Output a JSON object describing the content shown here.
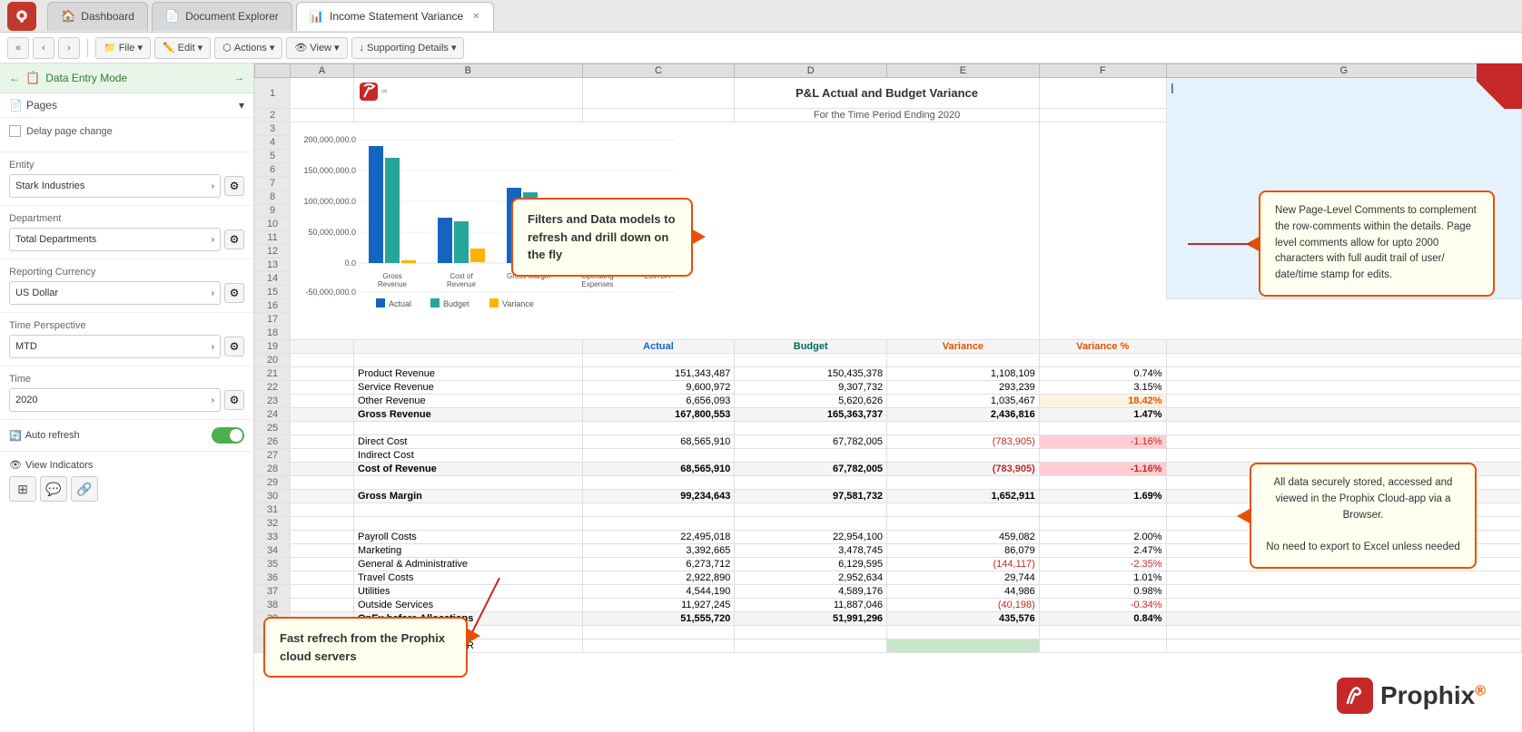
{
  "tabs": [
    {
      "id": "dashboard",
      "label": "Dashboard",
      "icon": "🏠",
      "active": false
    },
    {
      "id": "doc-explorer",
      "label": "Document Explorer",
      "icon": "📄",
      "active": false
    },
    {
      "id": "income-statement",
      "label": "Income Statement Variance",
      "icon": "📊",
      "active": true,
      "closable": true
    }
  ],
  "toolbar": {
    "nav_back_back": "«",
    "nav_back": "‹",
    "nav_forward": "›",
    "file_label": "File",
    "edit_label": "Edit",
    "actions_label": "Actions",
    "view_label": "View",
    "supporting_details_label": "Supporting Details"
  },
  "sidebar": {
    "data_entry_mode": "Data Entry Mode",
    "pages_label": "Pages",
    "delay_page_change": "Delay page change",
    "entity_label": "Entity",
    "entity_value": "Stark Industries",
    "department_label": "Department",
    "department_value": "Total Departments",
    "reporting_currency_label": "Reporting Currency",
    "reporting_currency_value": "US Dollar",
    "time_perspective_label": "Time Perspective",
    "time_perspective_value": "MTD",
    "time_label": "Time",
    "time_value": "2020",
    "auto_refresh_label": "Auto refresh",
    "view_indicators_label": "View Indicators"
  },
  "spreadsheet": {
    "title": "P&L Actual and Budget Variance",
    "subtitle": "For the Time Period Ending 2020",
    "columns": [
      "A",
      "B",
      "C",
      "D",
      "E",
      "F",
      "G"
    ],
    "col_headers": [
      "",
      "A",
      "B",
      "C",
      "D",
      "E",
      "F",
      "G"
    ],
    "rows": [
      {
        "num": 1,
        "cells": [
          "",
          "",
          "",
          "",
          "",
          "",
          ""
        ]
      },
      {
        "num": 2,
        "cells": [
          "",
          "",
          "",
          "P&L Actual and Budget Variance",
          "",
          "",
          ""
        ]
      },
      {
        "num": 3,
        "cells": [
          "",
          "",
          "",
          "For the Time Period Ending 2020",
          "",
          "",
          ""
        ]
      },
      {
        "num": 19,
        "cells": [
          "",
          "",
          "",
          "Actual",
          "Budget",
          "Variance",
          "Variance %"
        ],
        "header": true
      },
      {
        "num": 21,
        "cells": [
          "",
          "Product Revenue",
          "",
          "151,343,487",
          "150,435,378",
          "1,108,109",
          "0.74%"
        ]
      },
      {
        "num": 22,
        "cells": [
          "",
          "Service Revenue",
          "",
          "9,600,972",
          "9,307,732",
          "293,239",
          "3.15%"
        ]
      },
      {
        "num": 23,
        "cells": [
          "",
          "Other Revenue",
          "",
          "6,656,093",
          "5,620,626",
          "1,035,467",
          "18.42%"
        ],
        "highlight_variance": true
      },
      {
        "num": 24,
        "cells": [
          "",
          "Gross Revenue",
          "",
          "167,800,553",
          "165,363,737",
          "2,436,816",
          "1.47%"
        ],
        "bold": true
      },
      {
        "num": 25,
        "cells": [
          "",
          "",
          "",
          "",
          "",
          "",
          ""
        ]
      },
      {
        "num": 26,
        "cells": [
          "",
          "Direct Cost",
          "",
          "68,565,910",
          "67,782,005",
          "(783,905)",
          "-1.16%"
        ],
        "neg": true
      },
      {
        "num": 27,
        "cells": [
          "",
          "Indirect Cost",
          "",
          "",
          "",
          "",
          ""
        ]
      },
      {
        "num": 28,
        "cells": [
          "",
          "Cost of Revenue",
          "",
          "68,565,910",
          "67,782,005",
          "(783,905)",
          "-1.16%"
        ],
        "bold": true,
        "neg": true
      },
      {
        "num": 29,
        "cells": [
          "",
          "",
          "",
          "",
          "",
          "",
          ""
        ]
      },
      {
        "num": 30,
        "cells": [
          "",
          "Gross Margin",
          "",
          "99,234,643",
          "97,581,732",
          "1,652,911",
          "1.69%"
        ],
        "bold": true
      },
      {
        "num": 31,
        "cells": [
          "",
          "",
          "",
          "",
          "",
          "",
          ""
        ]
      },
      {
        "num": 32,
        "cells": [
          "",
          "",
          "",
          "",
          "",
          "",
          ""
        ]
      },
      {
        "num": 33,
        "cells": [
          "",
          "Payroll Costs",
          "",
          "22,495,018",
          "22,954,100",
          "459,082",
          "2.00%"
        ]
      },
      {
        "num": 34,
        "cells": [
          "",
          "Marketing",
          "",
          "3,392,665",
          "3,478,745",
          "86,079",
          "2.47%"
        ]
      },
      {
        "num": 35,
        "cells": [
          "",
          "General & Administrative",
          "",
          "6,273,712",
          "6,129,595",
          "(144,117)",
          "-2.35%"
        ]
      },
      {
        "num": 36,
        "cells": [
          "",
          "Travel Costs",
          "",
          "2,922,890",
          "2,952,634",
          "29,744",
          "1.01%"
        ]
      },
      {
        "num": 37,
        "cells": [
          "",
          "Utilities",
          "",
          "4,544,190",
          "4,589,176",
          "44,986",
          "0.98%"
        ]
      },
      {
        "num": 38,
        "cells": [
          "",
          "Outside Services",
          "",
          "11,927,245",
          "11,887,046",
          "(40,198)",
          "-0.34%"
        ]
      },
      {
        "num": 39,
        "cells": [
          "",
          "OpEx before Allocations",
          "",
          "51,555,720",
          "51,991,296",
          "435,576",
          "0.84%"
        ],
        "bold": true
      },
      {
        "num": 40,
        "cells": [
          "",
          "",
          "",
          "",
          "",
          "",
          ""
        ]
      },
      {
        "num": 41,
        "cells": [
          "",
          "Allocated Overheads - HR",
          "",
          "",
          "",
          "",
          ""
        ],
        "green_bg": true
      }
    ],
    "chart": {
      "title": "P&L Actual and Budget Variance",
      "bars": [
        {
          "label": "Gross\nRevenue",
          "actual": 167,
          "budget": 150,
          "variance": 10
        },
        {
          "label": "Cost of\nRevenue",
          "actual": 68,
          "budget": 67,
          "variance": -5
        },
        {
          "label": "Gross Margin",
          "actual": 99,
          "budget": 97,
          "variance": 8
        },
        {
          "label": "Operating\nExpenses",
          "actual": 51,
          "budget": 51,
          "variance": 4
        },
        {
          "label": "EBITDA",
          "actual": 45,
          "budget": 43,
          "variance": 3
        }
      ],
      "legend": [
        "Actual",
        "Budget",
        "Variance"
      ],
      "y_labels": [
        "200,000,000.0",
        "150,000,000.0",
        "100,000,000.0",
        "50,000,000.0",
        "0.0",
        "-50,000,000.0"
      ]
    }
  },
  "callouts": {
    "filters": "Filters and Data models to refresh and drill down on the fly",
    "page_comments": "New Page-Level Comments to complement the row-comments within the details. Page level comments allow for upto 2000 characters with full audit trail of user/ date/time stamp for edits.",
    "data_stored": "All data securely stored, accessed and viewed in the Prophix Cloud-app via a Browser.\nNo need to export to Excel unless needed",
    "fast_refresh": "Fast refrech from the Prophix cloud servers"
  },
  "prophix": {
    "logo_text": "Prophix",
    "trademark": "®"
  }
}
